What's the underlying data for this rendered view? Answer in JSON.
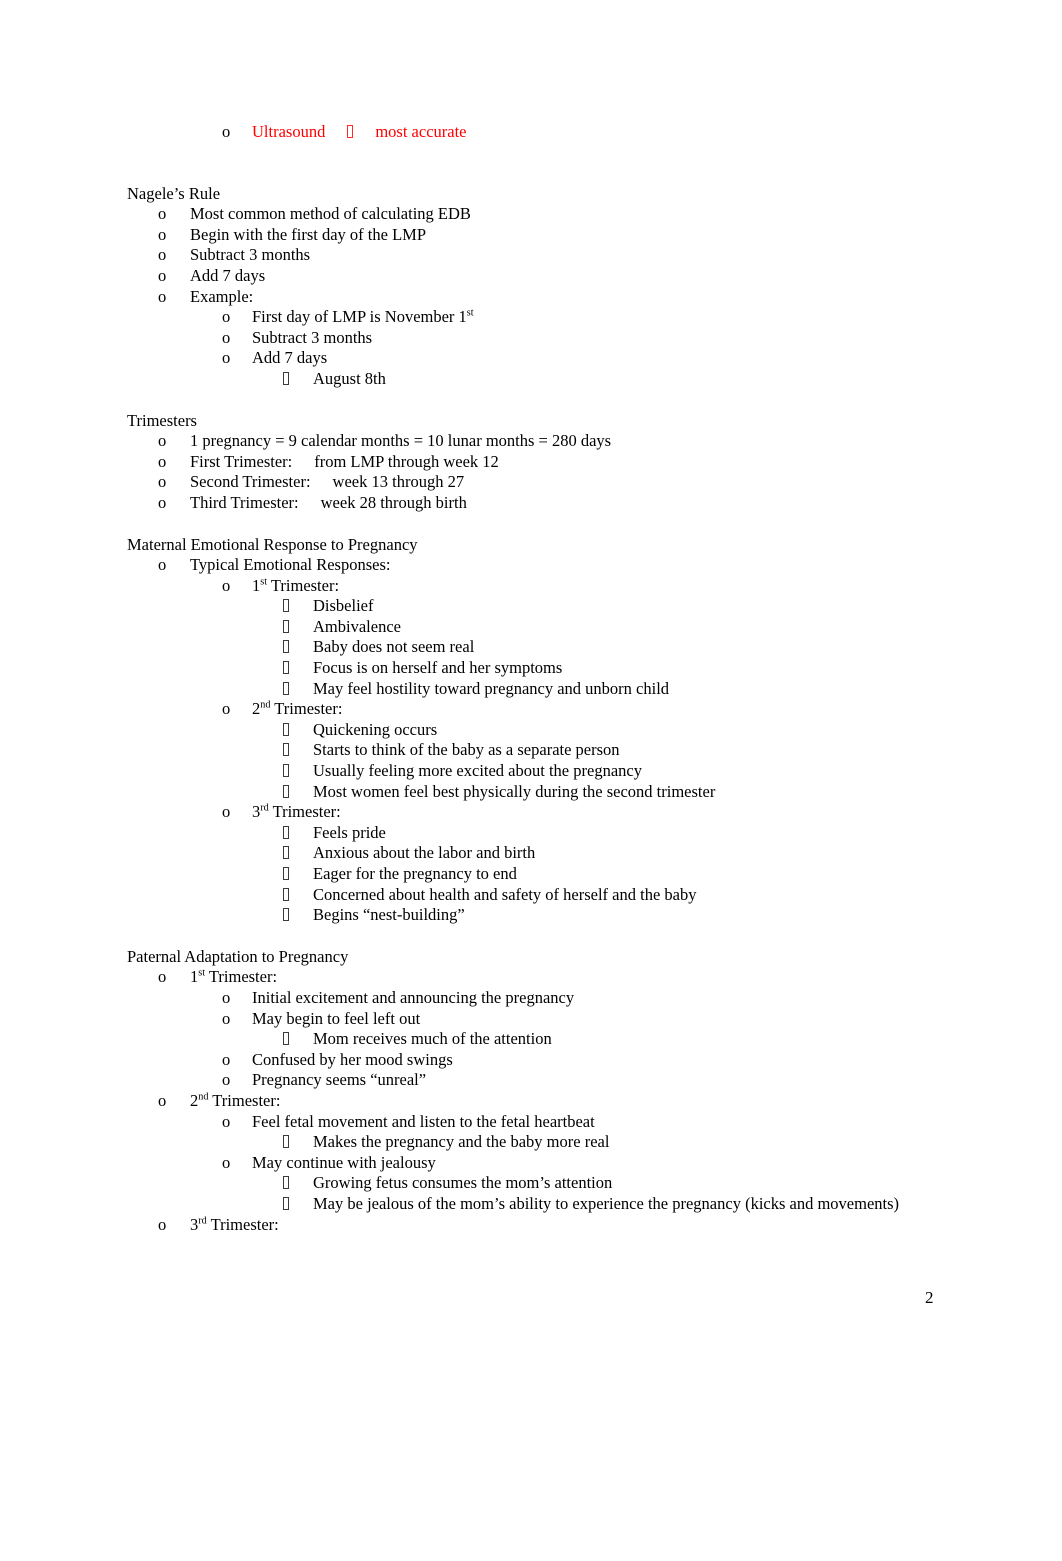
{
  "document": {
    "page_number": "2",
    "accent_color": "#ff0000",
    "text_color": "#000000"
  },
  "top_item": {
    "bullet": "o",
    "text_before": "Ultrasound",
    "symbol": "arrow-box-glyph",
    "text_after": "most accurate"
  },
  "sections": [
    {
      "heading": "Nagele’s Rule",
      "items": [
        {
          "level": 1,
          "bullet": "o",
          "text": "Most common method of calculating EDB"
        },
        {
          "level": 1,
          "bullet": "o",
          "text": "Begin with the first day of the LMP"
        },
        {
          "level": 1,
          "bullet": "o",
          "text": "Subtract 3 months"
        },
        {
          "level": 1,
          "bullet": "o",
          "text": "Add 7 days"
        },
        {
          "level": 1,
          "bullet": "o",
          "text": "Example:"
        },
        {
          "level": 2,
          "bullet": "o",
          "text": "First day of LMP is November 1",
          "sup": "st"
        },
        {
          "level": 2,
          "bullet": "o",
          "text": "Subtract 3 months"
        },
        {
          "level": 2,
          "bullet": "o",
          "text": "Add 7 days"
        },
        {
          "level": 3,
          "bullet": "box",
          "text": "August 8th"
        }
      ]
    },
    {
      "heading": "Trimesters",
      "items": [
        {
          "level": 1,
          "bullet": "o",
          "text": "1 pregnancy = 9 calendar months = 10 lunar months = 280 days"
        },
        {
          "level": 1,
          "bullet": "o",
          "text": "First Trimester:",
          "tab": "from LMP through week 12"
        },
        {
          "level": 1,
          "bullet": "o",
          "text": "Second Trimester:",
          "tab": "week 13 through 27"
        },
        {
          "level": 1,
          "bullet": "o",
          "text": "Third Trimester:",
          "tab": "week 28 through birth"
        }
      ]
    },
    {
      "heading": "Maternal Emotional Response to Pregnancy",
      "items": [
        {
          "level": 1,
          "bullet": "o",
          "text": "Typical Emotional Responses:"
        },
        {
          "level": 2,
          "bullet": "o",
          "text": "1",
          "sup": "st",
          "text_after": " Trimester:"
        },
        {
          "level": 3,
          "bullet": "box",
          "text": "Disbelief"
        },
        {
          "level": 3,
          "bullet": "box",
          "text": "Ambivalence"
        },
        {
          "level": 3,
          "bullet": "box",
          "text": "Baby does not seem real"
        },
        {
          "level": 3,
          "bullet": "box",
          "text": "Focus is on herself and her symptoms"
        },
        {
          "level": 3,
          "bullet": "box",
          "text": "May feel hostility toward pregnancy and unborn child"
        },
        {
          "level": 2,
          "bullet": "o",
          "text": "2",
          "sup": "nd",
          "text_after": " Trimester:"
        },
        {
          "level": 3,
          "bullet": "box",
          "text": "Quickening occurs"
        },
        {
          "level": 3,
          "bullet": "box",
          "text": "Starts to think of the baby as a separate person"
        },
        {
          "level": 3,
          "bullet": "box",
          "text": "Usually feeling more excited about the pregnancy"
        },
        {
          "level": 3,
          "bullet": "box",
          "text": "Most women feel best physically during the second trimester"
        },
        {
          "level": 2,
          "bullet": "o",
          "text": "3",
          "sup": "rd",
          "text_after": " Trimester:"
        },
        {
          "level": 3,
          "bullet": "box",
          "text": "Feels pride"
        },
        {
          "level": 3,
          "bullet": "box",
          "text": "Anxious about the labor and birth"
        },
        {
          "level": 3,
          "bullet": "box",
          "text": "Eager for the pregnancy to end"
        },
        {
          "level": 3,
          "bullet": "box",
          "text": "Concerned about health and safety of herself and the baby"
        },
        {
          "level": 3,
          "bullet": "box",
          "text": "Begins “nest-building”"
        }
      ]
    },
    {
      "heading": "Paternal Adaptation to Pregnancy",
      "items": [
        {
          "level": 1,
          "bullet": "o",
          "text": "1",
          "sup": "st",
          "text_after": " Trimester:"
        },
        {
          "level": 2,
          "bullet": "o",
          "text": "Initial excitement and announcing the pregnancy"
        },
        {
          "level": 2,
          "bullet": "o",
          "text": "May begin to feel left out"
        },
        {
          "level": 3,
          "bullet": "box",
          "text": "Mom receives much of the attention"
        },
        {
          "level": 2,
          "bullet": "o",
          "text": "Confused by her mood swings"
        },
        {
          "level": 2,
          "bullet": "o",
          "text": "Pregnancy seems “unreal”"
        },
        {
          "level": 1,
          "bullet": "o",
          "text": "2",
          "sup": "nd",
          "text_after": " Trimester:"
        },
        {
          "level": 2,
          "bullet": "o",
          "text": "Feel fetal movement and listen to the fetal heartbeat"
        },
        {
          "level": 3,
          "bullet": "box",
          "text": "Makes the pregnancy and the baby more real"
        },
        {
          "level": 2,
          "bullet": "o",
          "text": "May continue with jealousy"
        },
        {
          "level": 3,
          "bullet": "box",
          "text": "Growing fetus consumes the mom’s attention"
        },
        {
          "level": 3,
          "bullet": "box",
          "text": "May be jealous of the mom’s ability to experience the pregnancy (kicks and movements)"
        },
        {
          "level": 1,
          "bullet": "o",
          "text": "3",
          "sup": "rd",
          "text_after": " Trimester:"
        }
      ]
    }
  ]
}
